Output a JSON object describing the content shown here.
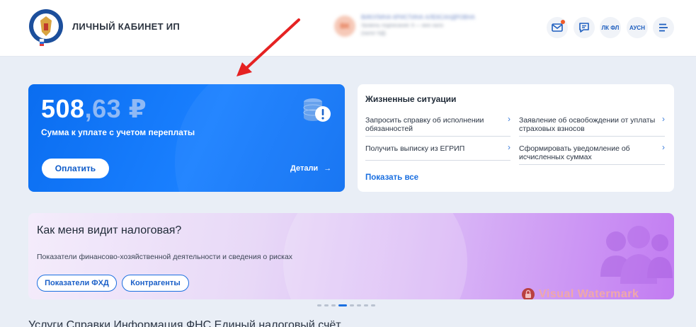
{
  "header": {
    "app_title": "ЛИЧНЫЙ КАБИНЕТ ИП",
    "user": {
      "avatar_initials": "ВК",
      "name": "ВИКУЛИНА КРИСТИНА АЛЕКСАНДРОВНА",
      "line1": "Уровень подписания: 6 — мне нало",
      "line2": "(налог НД)"
    },
    "buttons": {
      "lk_fl": "ЛК ФЛ",
      "ausn": "АУСН"
    }
  },
  "pay_card": {
    "amount_int": "508",
    "amount_rest": ",63 ₽",
    "label": "Сумма к уплате с учетом переплаты",
    "pay_button": "Оплатить",
    "details": "Детали",
    "details_arrow": "→"
  },
  "life": {
    "title": "Жизненные ситуации",
    "items": [
      {
        "label": "Запросить справку об исполнении обязанностей"
      },
      {
        "label": "Заявление об освобождении от уплаты страховых взносов"
      },
      {
        "label": "Получить выписку из ЕГРИП"
      },
      {
        "label": "Сформировать уведомление об исчисленных суммах"
      }
    ],
    "chevron": "›",
    "show_all": "Показать все"
  },
  "tax_banner": {
    "title": "Как меня видит налоговая?",
    "desc": "Показатели финансово-хозяйственной деятельности и сведения о рисках",
    "pill1": "Показатели ФХД",
    "pill2": "Контрагенты"
  },
  "watermark": "Visual Watermark",
  "bottom_row": "Услуги     Справки                          Информация           ФНС              Единый налоговый счёт"
}
